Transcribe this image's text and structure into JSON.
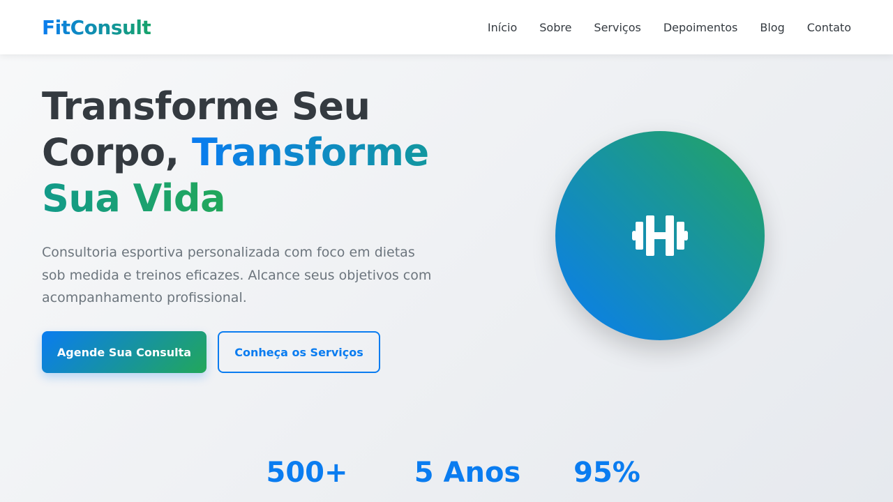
{
  "brand": {
    "name": "FitConsult"
  },
  "nav": {
    "items": [
      {
        "label": "Início"
      },
      {
        "label": "Sobre"
      },
      {
        "label": "Serviços"
      },
      {
        "label": "Depoimentos"
      },
      {
        "label": "Blog"
      },
      {
        "label": "Contato"
      }
    ]
  },
  "hero": {
    "title_part1": "Transforme Seu Corpo, ",
    "title_part2": "Transforme",
    "title_part3": "Sua Vida",
    "subtitle": "Consultoria esportiva personalizada com foco em dietas sob medida e treinos eficazes. Alcance seus objetivos com acompanhamento profissional.",
    "primary_button": "Agende Sua Consulta",
    "secondary_button": "Conheça os Serviços",
    "icon": "dumbbell-icon"
  },
  "stats": [
    {
      "value": "500+"
    },
    {
      "value": "5 Anos"
    },
    {
      "value": "95%"
    }
  ],
  "colors": {
    "primary": "#0a7cf0",
    "secondary": "#22a75a",
    "text_dark": "#343a40",
    "text_muted": "#6c757d"
  }
}
